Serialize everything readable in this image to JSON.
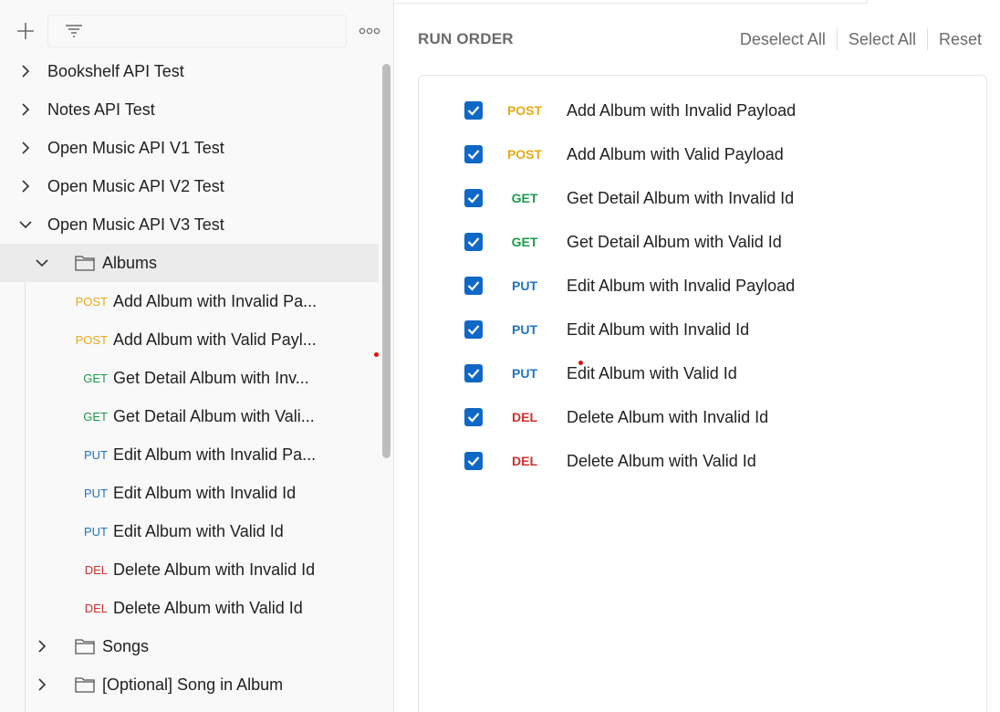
{
  "sidebar": {
    "collections": [
      {
        "label": "Bookshelf API Test",
        "expanded": false
      },
      {
        "label": "Notes API Test",
        "expanded": false
      },
      {
        "label": "Open Music API V1 Test",
        "expanded": false
      },
      {
        "label": "Open Music API V2 Test",
        "expanded": false
      },
      {
        "label": "Open Music API V3 Test",
        "expanded": true
      }
    ],
    "folders": [
      {
        "label": "Albums",
        "expanded": true
      },
      {
        "label": "Songs",
        "expanded": false
      },
      {
        "label": "[Optional] Song in Album",
        "expanded": false
      }
    ],
    "requests": [
      {
        "method": "POST",
        "label": "Add Album with Invalid Pa..."
      },
      {
        "method": "POST",
        "label": "Add Album with Valid Payl..."
      },
      {
        "method": "GET",
        "label": "Get Detail Album with Inv..."
      },
      {
        "method": "GET",
        "label": "Get Detail Album with Vali..."
      },
      {
        "method": "PUT",
        "label": "Edit Album with Invalid Pa..."
      },
      {
        "method": "PUT",
        "label": "Edit Album with Invalid Id"
      },
      {
        "method": "PUT",
        "label": "Edit Album with Valid Id"
      },
      {
        "method": "DEL",
        "label": "Delete Album with Invalid Id"
      },
      {
        "method": "DEL",
        "label": "Delete Album with Valid Id"
      }
    ]
  },
  "run_order": {
    "title": "RUN ORDER",
    "actions": {
      "deselect_all": "Deselect All",
      "select_all": "Select All",
      "reset": "Reset"
    },
    "items": [
      {
        "method": "POST",
        "label": "Add Album with Invalid Payload",
        "checked": true
      },
      {
        "method": "POST",
        "label": "Add Album with Valid Payload",
        "checked": true
      },
      {
        "method": "GET",
        "label": "Get Detail Album with Invalid Id",
        "checked": true
      },
      {
        "method": "GET",
        "label": "Get Detail Album with Valid Id",
        "checked": true
      },
      {
        "method": "PUT",
        "label": "Edit Album with Invalid Payload",
        "checked": true
      },
      {
        "method": "PUT",
        "label": "Edit Album with Invalid Id",
        "checked": true
      },
      {
        "method": "PUT",
        "label": "Edit Album with Valid Id",
        "checked": true
      },
      {
        "method": "DEL",
        "label": "Delete Album with Invalid Id",
        "checked": true
      },
      {
        "method": "DEL",
        "label": "Delete Album with Valid Id",
        "checked": true
      }
    ]
  },
  "colors": {
    "post": "#e8a913",
    "get": "#1c9a4c",
    "put": "#1f73c4",
    "del": "#d2302e",
    "checkbox": "#1068c6"
  },
  "icons": {
    "new": "plus-icon",
    "filter": "filter-icon",
    "more": "more-options-icon",
    "folder": "folder-icon",
    "expand": "chevron-right-icon",
    "collapse": "chevron-down-icon",
    "check": "checkmark-icon"
  }
}
